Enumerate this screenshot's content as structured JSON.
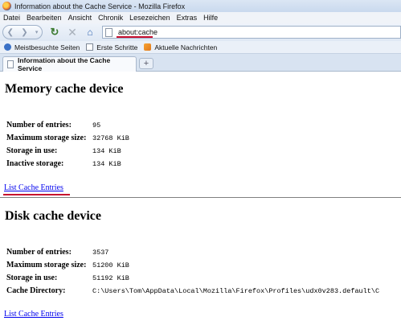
{
  "window": {
    "title": "Information about the Cache Service - Mozilla Firefox"
  },
  "menubar": {
    "items": [
      "Datei",
      "Bearbeiten",
      "Ansicht",
      "Chronik",
      "Lesezeichen",
      "Extras",
      "Hilfe"
    ]
  },
  "navbar": {
    "url": "about:cache"
  },
  "bookmarks": {
    "items": [
      "Meistbesuchte Seiten",
      "Erste Schritte",
      "Aktuelle Nachrichten"
    ]
  },
  "tabs": {
    "active_label": "Information about the Cache Service",
    "new_tab": "+"
  },
  "memory": {
    "heading": "Memory cache device",
    "rows": [
      {
        "label": "Number of entries:",
        "value": "95"
      },
      {
        "label": "Maximum storage size:",
        "value": "32768 KiB"
      },
      {
        "label": "Storage in use:",
        "value": "134 KiB"
      },
      {
        "label": "Inactive storage:",
        "value": "134 KiB"
      }
    ],
    "link": "List Cache Entries"
  },
  "disk": {
    "heading": "Disk cache device",
    "rows": [
      {
        "label": "Number of entries:",
        "value": "3537"
      },
      {
        "label": "Maximum storage size:",
        "value": "51200 KiB"
      },
      {
        "label": "Storage in use:",
        "value": "51192 KiB"
      },
      {
        "label": "Cache Directory:",
        "value": "C:\\Users\\Tom\\AppData\\Local\\Mozilla\\Firefox\\Profiles\\udx0v283.default\\C"
      }
    ],
    "link": "List Cache Entries"
  },
  "colors": {
    "annotation_red": "#c8102e",
    "link_blue": "#0000ee"
  }
}
